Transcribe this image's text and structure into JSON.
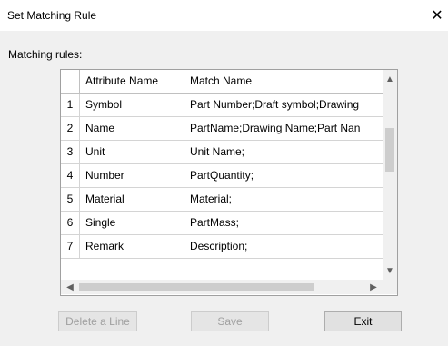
{
  "window": {
    "title": "Set Matching Rule",
    "close_glyph": "✕"
  },
  "section_label": "Matching rules:",
  "table": {
    "columns": [
      "",
      "Attribute Name",
      "Match Name"
    ],
    "rows": [
      {
        "num": "1",
        "attribute": "Symbol",
        "match": "Part Number;Draft symbol;Drawing"
      },
      {
        "num": "2",
        "attribute": "Name",
        "match": "PartName;Drawing Name;Part Nan"
      },
      {
        "num": "3",
        "attribute": "Unit",
        "match": "Unit Name;"
      },
      {
        "num": "4",
        "attribute": "Number",
        "match": "PartQuantity;"
      },
      {
        "num": "5",
        "attribute": "Material",
        "match": "Material;"
      },
      {
        "num": "6",
        "attribute": "Single",
        "match": "PartMass;"
      },
      {
        "num": "7",
        "attribute": "Remark",
        "match": "Description;"
      }
    ]
  },
  "scrollbar_glyphs": {
    "up": "▲",
    "down": "▼",
    "left": "◀",
    "right": "▶"
  },
  "buttons": {
    "delete": {
      "label": "Delete a Line",
      "enabled": false
    },
    "save": {
      "label": "Save",
      "enabled": false
    },
    "exit": {
      "label": "Exit",
      "enabled": true
    }
  }
}
